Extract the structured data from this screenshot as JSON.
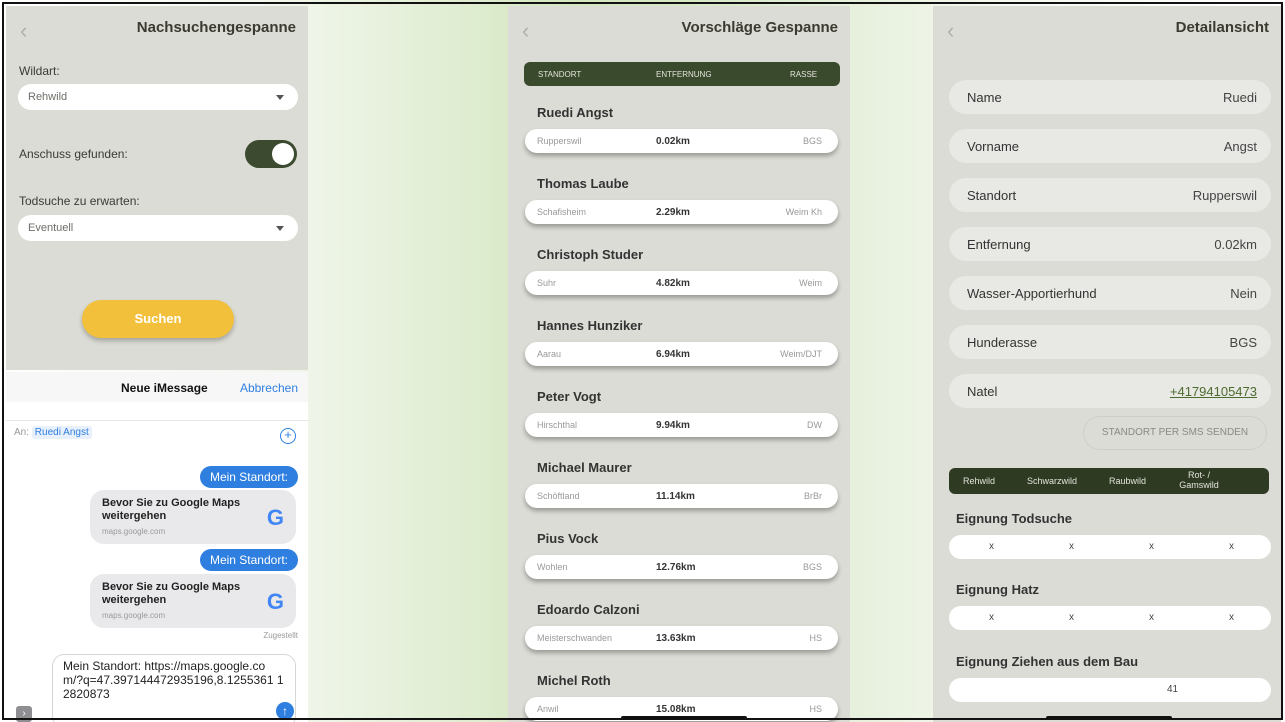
{
  "search": {
    "title": "Nachsuchengespanne",
    "wildart_label": "Wildart:",
    "wildart_value": "Rehwild",
    "anschuss_label": "Anschuss gefunden:",
    "anschuss_toggle": true,
    "todsuche_label": "Todsuche zu erwarten:",
    "todsuche_value": "Eventuell",
    "search_button": "Suchen"
  },
  "imessage": {
    "title": "Neue iMessage",
    "cancel": "Abbrechen",
    "to_label": "An:",
    "recipient": "Ruedi Angst",
    "bubble1": "Mein Standort:",
    "card1_title": "Bevor Sie zu Google Maps weitergehen",
    "card1_url": "maps.google.com",
    "bubble2": "Mein Standort:",
    "card2_title": "Bevor Sie zu Google Maps weitergehen",
    "card2_url": "maps.google.com",
    "delivered": "Zugestellt",
    "input_text": "Mein Standort: https://maps.google.com/?q=47.397144472935196,8.1255361 12820873"
  },
  "suggestions": {
    "title": "Vorschläge Gespanne",
    "columns": [
      "STANDORT",
      "ENTFERNUNG",
      "RASSE"
    ],
    "items": [
      {
        "name": "Ruedi Angst",
        "place": "Rupperswil",
        "dist": "0.02km",
        "breed": "BGS"
      },
      {
        "name": "Thomas Laube",
        "place": "Schafisheim",
        "dist": "2.29km",
        "breed": "Weim Kh"
      },
      {
        "name": "Christoph Studer",
        "place": "Suhr",
        "dist": "4.82km",
        "breed": "Weim"
      },
      {
        "name": "Hannes Hunziker",
        "place": "Aarau",
        "dist": "6.94km",
        "breed": "Weim/DJT"
      },
      {
        "name": "Peter Vogt",
        "place": "Hirschthal",
        "dist": "9.94km",
        "breed": "DW"
      },
      {
        "name": "Michael Maurer",
        "place": "Schöftland",
        "dist": "11.14km",
        "breed": "BrBr"
      },
      {
        "name": "Pius Vock",
        "place": "Wohlen",
        "dist": "12.76km",
        "breed": "BGS"
      },
      {
        "name": "Edoardo Calzoni",
        "place": "Meisterschwanden",
        "dist": "13.63km",
        "breed": "HS"
      },
      {
        "name": "Michel Roth",
        "place": "Anwil",
        "dist": "15.08km",
        "breed": "HS"
      }
    ]
  },
  "detail": {
    "title": "Detailansicht",
    "rows": [
      {
        "key": "Name",
        "value": "Ruedi"
      },
      {
        "key": "Vorname",
        "value": "Angst"
      },
      {
        "key": "Standort",
        "value": "Rupperswil"
      },
      {
        "key": "Entfernung",
        "value": "0.02km"
      },
      {
        "key": "Wasser-Apportierhund",
        "value": "Nein"
      },
      {
        "key": "Hunderasse",
        "value": "BGS"
      },
      {
        "key": "Natel",
        "value": "+41794105473"
      }
    ],
    "sms_button": "STANDORT PER SMS SENDEN",
    "tabs": [
      "Rehwild",
      "Schwarzwild",
      "Raubwild",
      "Rot- / Gamswild"
    ],
    "sections": [
      {
        "title": "Eignung Todsuche",
        "marks": [
          "x",
          "x",
          "x",
          "x"
        ]
      },
      {
        "title": "Eignung Hatz",
        "marks": [
          "x",
          "x",
          "x",
          "x"
        ]
      },
      {
        "title": "Eignung Ziehen aus dem Bau",
        "marks": [
          "41"
        ]
      }
    ]
  },
  "icons": {
    "back": "chevron-left-icon",
    "dropdown": "caret-down-icon",
    "send": "arrow-up-icon",
    "add": "plus-circle-icon",
    "google": "google-logo-icon"
  }
}
